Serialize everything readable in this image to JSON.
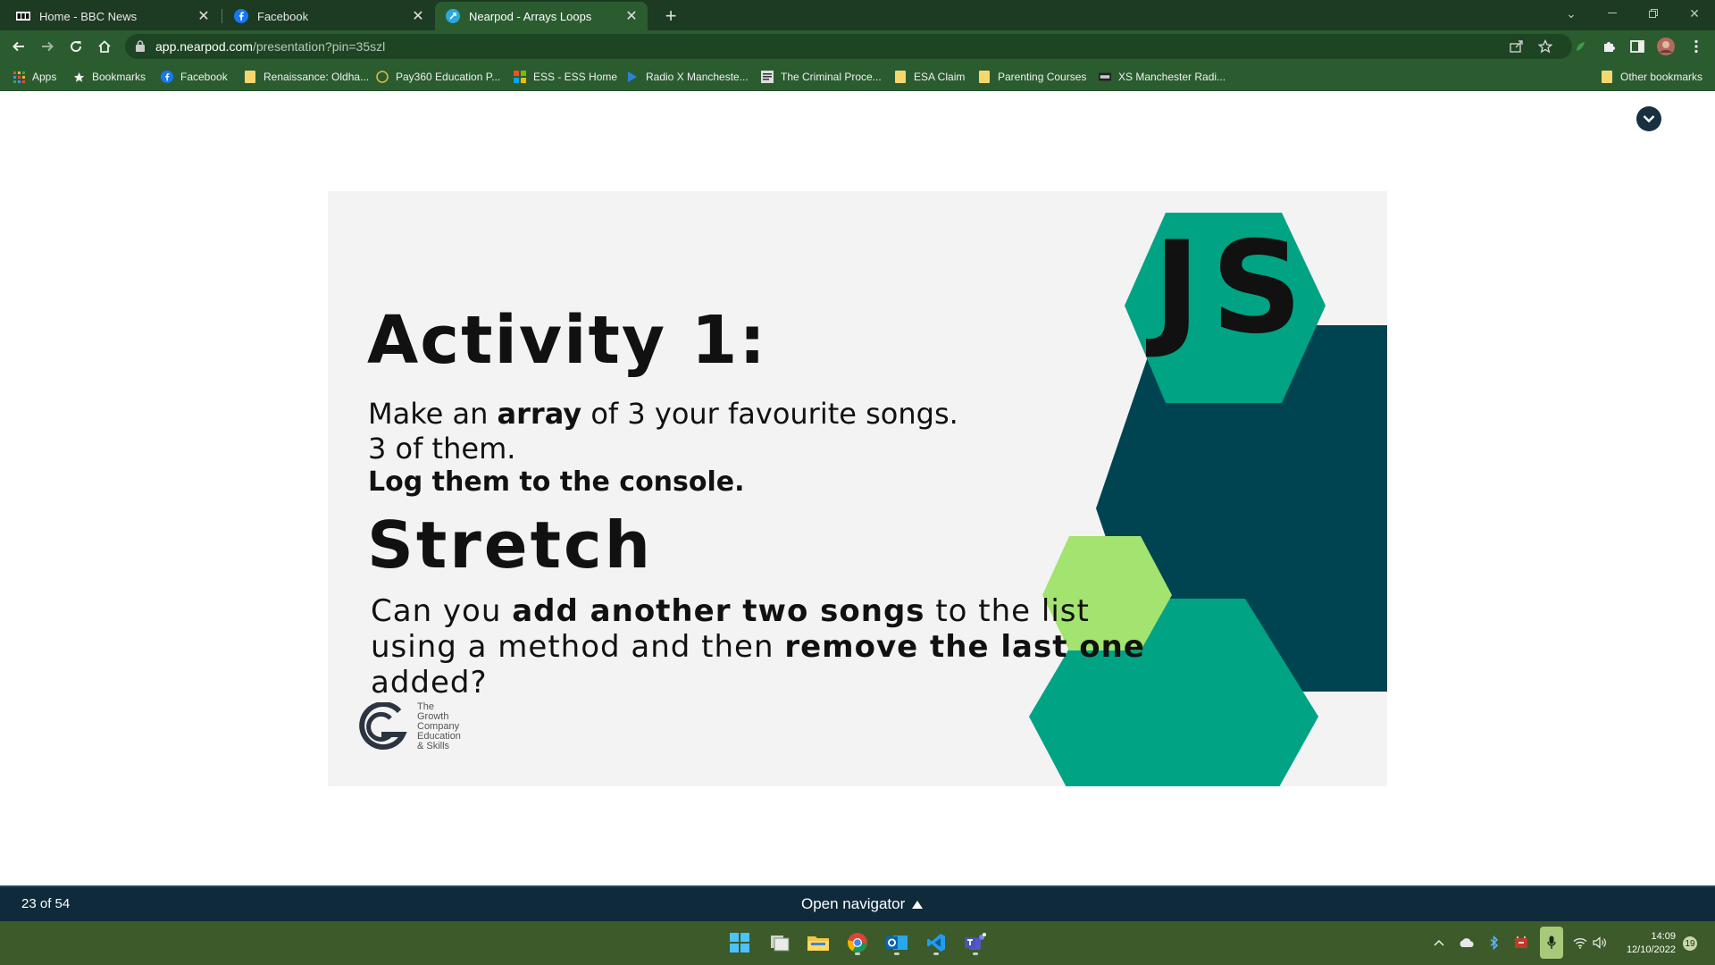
{
  "browser": {
    "tabs": [
      {
        "title": "Home - BBC News",
        "icon": "bbc-icon",
        "active": false
      },
      {
        "title": "Facebook",
        "icon": "facebook-icon",
        "active": false
      },
      {
        "title": "Nearpod - Arrays Loops",
        "icon": "nearpod-icon",
        "active": true
      }
    ],
    "url_host": "app.nearpod.com",
    "url_path": "/presentation?pin=35szl",
    "bookmarks": [
      {
        "label": "Apps",
        "icon": "apps-grid-icon"
      },
      {
        "label": "Bookmarks",
        "icon": "star-icon"
      },
      {
        "label": "Facebook",
        "icon": "facebook-icon"
      },
      {
        "label": "Renaissance: Oldha...",
        "icon": "folder-icon"
      },
      {
        "label": "Pay360 Education P...",
        "icon": "circle-icon"
      },
      {
        "label": "ESS - ESS Home",
        "icon": "grid-icon"
      },
      {
        "label": "Radio X Mancheste...",
        "icon": "radio-icon"
      },
      {
        "label": "The Criminal Proce...",
        "icon": "doc-icon"
      },
      {
        "label": "ESA Claim",
        "icon": "folder-icon"
      },
      {
        "label": "Parenting Courses",
        "icon": "folder-icon"
      },
      {
        "label": "XS Manchester Radi...",
        "icon": "xs-icon"
      }
    ],
    "other_bookmarks": "Other bookmarks"
  },
  "slide": {
    "title": "Activity 1:",
    "line1_pre": "Make an ",
    "line1_bold": "array",
    "line1_post": " of 3 your favourite songs.",
    "line2": "3 of them.",
    "line3": "Log them to the console.",
    "stretch_heading": "Stretch",
    "s1_pre": "Can you ",
    "s1_bold": "add another two songs",
    "s1_post": " to the list",
    "s2_pre": "using a method and then ",
    "s2_bold": "remove the last one",
    "s3": "added?",
    "js_badge": "JS",
    "logo_lines": [
      "The",
      "Growth",
      "Company",
      "Education",
      "& Skills"
    ],
    "colors": {
      "teal": "#00a383",
      "dark_teal": "#004451",
      "lime": "#a3e36f",
      "background": "#f3f3f3"
    }
  },
  "nearpod": {
    "counter": "23 of 54",
    "navigator_label": "Open navigator"
  },
  "taskbar": {
    "time": "14:09",
    "date": "12/10/2022",
    "notification_count": "19"
  }
}
